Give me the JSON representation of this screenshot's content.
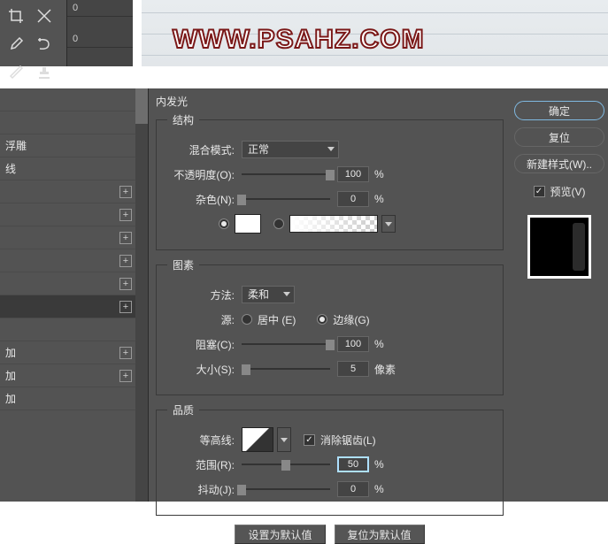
{
  "toolbar": {
    "opt_num1": "0",
    "opt_num2": "0"
  },
  "watermark": "WWW.PSAHZ.COM",
  "styles_panel": {
    "items": [
      {
        "label": "",
        "add": false
      },
      {
        "label": "",
        "add": false
      },
      {
        "label": "浮雕",
        "add": false
      },
      {
        "label": "线",
        "add": false
      },
      {
        "label": "",
        "add": true
      },
      {
        "label": "",
        "add": true
      },
      {
        "label": "",
        "add": true
      },
      {
        "label": "",
        "add": true
      },
      {
        "label": "",
        "add": true
      },
      {
        "label": "",
        "add": true,
        "selected": true
      },
      {
        "label": "",
        "add": false
      },
      {
        "label": "加",
        "add": true
      },
      {
        "label": "加",
        "add": true
      },
      {
        "label": "加",
        "add": false
      }
    ]
  },
  "dialog": {
    "title": "内发光",
    "fs1": {
      "legend": "结构",
      "blend_label": "混合模式:",
      "blend_value": "正常",
      "opacity_label": "不透明度(O):",
      "opacity_value": "100",
      "noise_label": "杂色(N):",
      "noise_value": "0"
    },
    "fs2": {
      "legend": "图素",
      "method_label": "方法:",
      "method_value": "柔和",
      "source_label": "源:",
      "center_label": "居中 (E)",
      "edge_label": "边缘(G)",
      "choke_label": "阻塞(C):",
      "choke_value": "100",
      "size_label": "大小(S):",
      "size_value": "5",
      "size_unit": "像素"
    },
    "fs3": {
      "legend": "品质",
      "contour_label": "等高线:",
      "antialias_label": "消除锯齿(L)",
      "range_label": "范围(R):",
      "range_value": "50",
      "jitter_label": "抖动(J):",
      "jitter_value": "0"
    },
    "set_default": "设置为默认值",
    "reset_default": "复位为默认值",
    "percent": "%"
  },
  "right": {
    "ok": "确定",
    "cancel": "复位",
    "new_style": "新建样式(W)..",
    "preview": "预览(V)"
  }
}
